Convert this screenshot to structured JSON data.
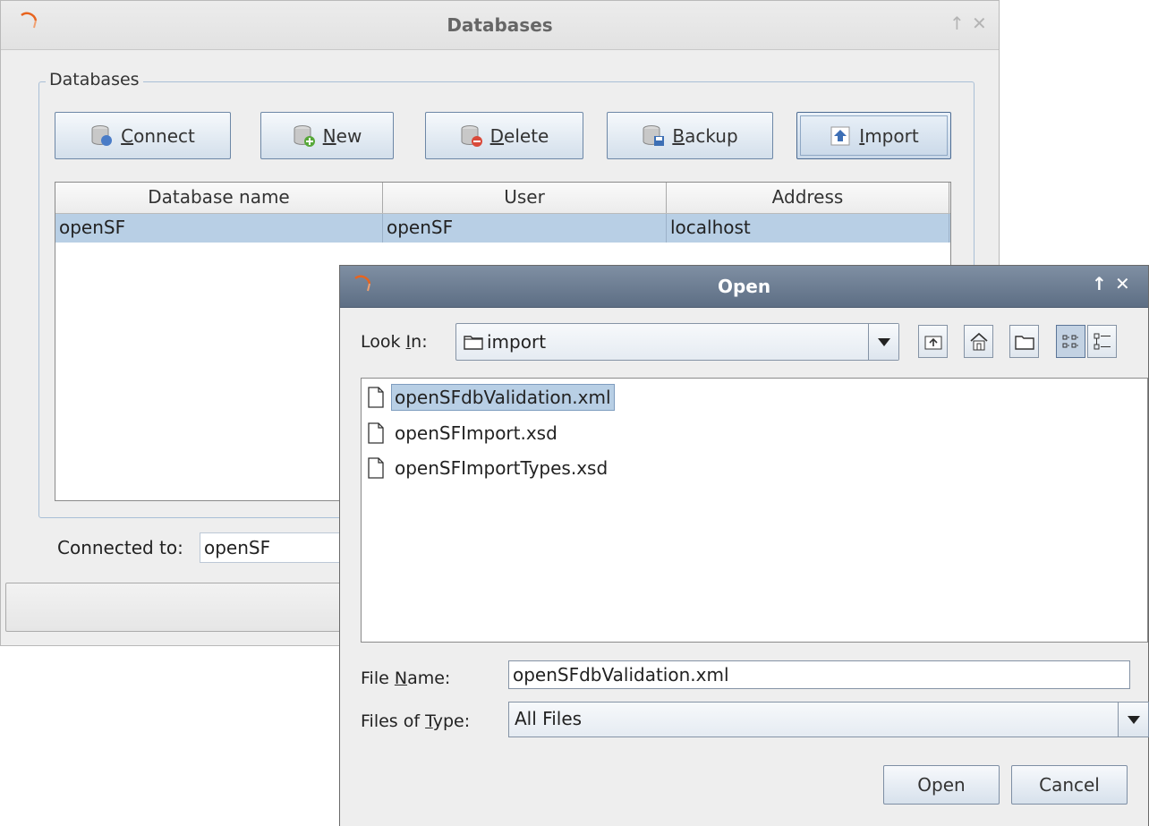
{
  "databases_window": {
    "title": "Databases",
    "controls": {
      "maximize": "↑",
      "close": "✕"
    },
    "group_label": "Databases",
    "toolbar": [
      {
        "key": "connect",
        "pre": "",
        "mnemonic": "C",
        "post": "onnect",
        "icon": "database-connect-icon"
      },
      {
        "key": "new",
        "pre": "",
        "mnemonic": "N",
        "post": "ew",
        "icon": "database-new-icon"
      },
      {
        "key": "delete",
        "pre": "",
        "mnemonic": "D",
        "post": "elete",
        "icon": "database-delete-icon"
      },
      {
        "key": "backup",
        "pre": "",
        "mnemonic": "B",
        "post": "ackup",
        "icon": "database-backup-icon"
      },
      {
        "key": "import",
        "pre": "",
        "mnemonic": "I",
        "post": "mport",
        "icon": "import-icon"
      }
    ],
    "table": {
      "columns": [
        "Database name",
        "User",
        "Address"
      ],
      "rows": [
        [
          "openSF",
          "openSF",
          "localhost"
        ]
      ]
    },
    "connected_label": "Connected to:",
    "connected_value": "openSF"
  },
  "open_dialog": {
    "title": "Open",
    "controls": {
      "maximize": "↑",
      "close": "✕"
    },
    "look_in": {
      "pre": "Look ",
      "mnemonic": "I",
      "post": "n:",
      "value": "import"
    },
    "toolbar_icons": [
      "up-folder-icon",
      "home-icon",
      "new-folder-icon",
      "list-view-icon",
      "details-view-icon"
    ],
    "files": [
      {
        "name": "openSFdbValidation.xml",
        "selected": true
      },
      {
        "name": "openSFImport.xsd",
        "selected": false
      },
      {
        "name": "openSFImportTypes.xsd",
        "selected": false
      }
    ],
    "file_name": {
      "pre": "File ",
      "mnemonic": "N",
      "post": "ame:",
      "value": "openSFdbValidation.xml"
    },
    "file_type": {
      "pre": "Files of ",
      "mnemonic": "T",
      "post": "ype:",
      "value": "All Files"
    },
    "buttons": {
      "open": "Open",
      "cancel": "Cancel"
    }
  },
  "colors": {
    "selection": "#b8cfe5",
    "dialog_title": "#6c7d92",
    "window_bg": "#eeeeee"
  }
}
